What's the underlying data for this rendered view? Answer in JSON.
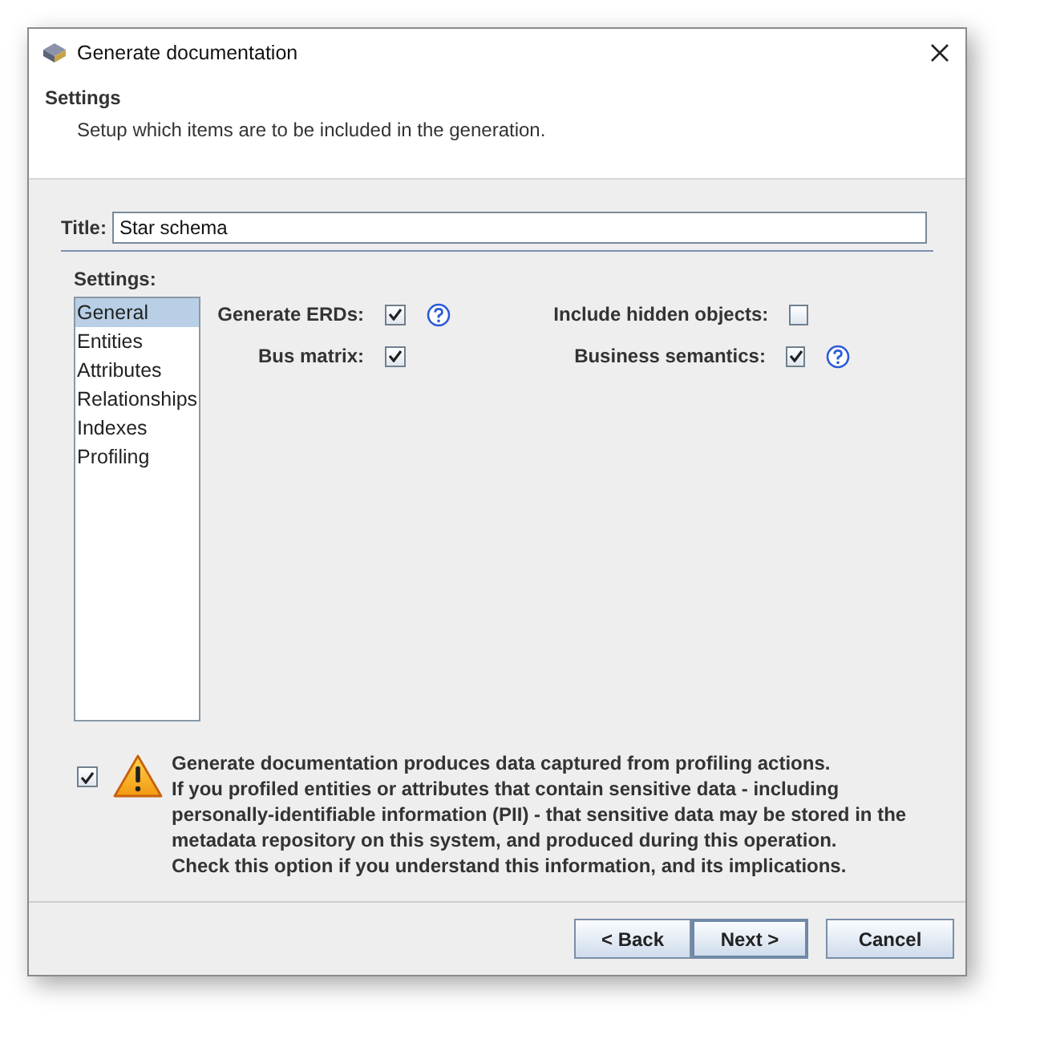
{
  "window": {
    "title": "Generate documentation"
  },
  "header": {
    "title": "Settings",
    "subtitle": "Setup which items are to be included in the generation."
  },
  "title_field": {
    "label": "Title:",
    "value": "Star schema"
  },
  "settings": {
    "label": "Settings:",
    "items": [
      {
        "label": "General",
        "selected": true
      },
      {
        "label": "Entities",
        "selected": false
      },
      {
        "label": "Attributes",
        "selected": false
      },
      {
        "label": "Relationships",
        "selected": false
      },
      {
        "label": "Indexes",
        "selected": false
      },
      {
        "label": "Profiling",
        "selected": false
      }
    ],
    "options": [
      {
        "label": "Generate ERDs:",
        "checked": true,
        "help": true
      },
      {
        "label": "Include hidden objects:",
        "checked": false,
        "help": false
      },
      {
        "label": "Bus matrix:",
        "checked": true,
        "help": false
      },
      {
        "label": "Business semantics:",
        "checked": true,
        "help": true
      }
    ]
  },
  "consent": {
    "checked": true,
    "text": "Generate documentation produces data captured from profiling actions.\nIf you profiled entities or attributes that contain sensitive data - including\npersonally-identifiable information (PII) - that sensitive data may be stored in the\nmetadata repository on this system, and produced during this operation.\nCheck this option if you understand this information, and its implications."
  },
  "buttons": [
    {
      "label": "< Back",
      "kind": "back"
    },
    {
      "label": "Next >",
      "kind": "next"
    },
    {
      "label": "Cancel",
      "kind": "cancel"
    }
  ]
}
